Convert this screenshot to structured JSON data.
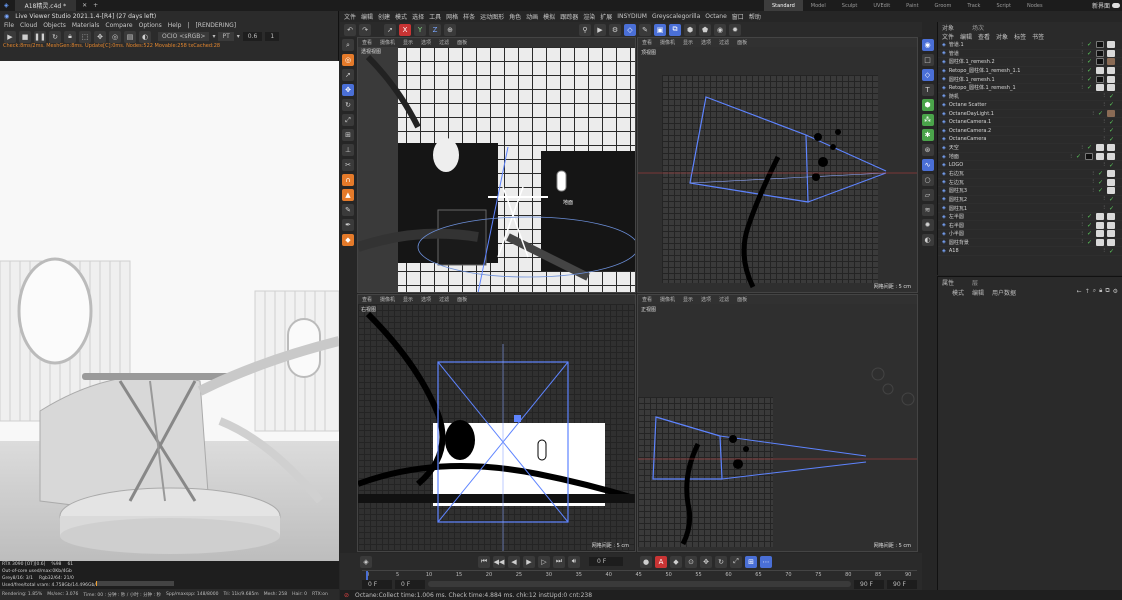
{
  "titlebar": {
    "doc_tab": "A18精灵.c4d *",
    "window_controls": [
      "─",
      "▢",
      "✕"
    ]
  },
  "liveviewer": {
    "title": "Live Viewer Studio 2021.1.4-[R4] (27 days left)",
    "menu": [
      "File",
      "Cloud",
      "Objects",
      "Materials",
      "Compare",
      "Options",
      "Help",
      "|",
      "[RENDERING]"
    ],
    "toolbar": {
      "ocio": "OCIO <sRGB>",
      "pt": "PT",
      "value": "0.6",
      "passes": "1"
    },
    "status_line": "Check:8ms/2ms. MeshGen:8ms. Update[C]:0ms. Nodes:522 Movable:258 txCached:28",
    "stats": [
      {
        "left": "RTX 3090 [OT][0.6]",
        "mid": "%98",
        "right": "61"
      },
      {
        "left": "Out-of-core used/max:0Kb/4Gb",
        "mid": "",
        "right": ""
      },
      {
        "left": "Grey8/16: 3/1",
        "mid": "Rgb32/64: 21/0",
        "right": ""
      },
      {
        "left": "Used/free/total vram: 4.758Gb/14.496Gb/24Gb",
        "mid": "",
        "right": ""
      }
    ],
    "bottom_status": {
      "rendering": "Rendering: 1.85%",
      "ms": "Ms/sec: 3.076",
      "time": "Time: 00 : 分钟 : 秒 / 小时 : 分钟 : 秒",
      "spp": "Spp/maxspp: 148/8000",
      "tri": "Tri: 11k/9.685m",
      "mesh": "Mesh: 258",
      "hair": "Hair: 0",
      "rtx": "RTX:on"
    },
    "progress": 0.0185
  },
  "c4d": {
    "menu": [
      "文件",
      "编辑",
      "创建",
      "模式",
      "选择",
      "工具",
      "网格",
      "样条",
      "运动图形",
      "角色",
      "动画",
      "模拟",
      "跟踪器",
      "渲染",
      "扩展",
      "INSYDIUM",
      "Greyscalegorilla",
      "Octane",
      "窗口",
      "帮助"
    ],
    "layouts": [
      "Standard",
      "Model",
      "Sculpt",
      "UVEdit",
      "Paint",
      "Groom",
      "Track",
      "Script",
      "Nodes"
    ],
    "active_layout": "Standard",
    "new_interface": "新界面",
    "top_toolbar": [
      "X",
      "Y",
      "Z"
    ],
    "viewports": [
      {
        "name": "透视视图",
        "menu": [
          "查看",
          "摄像机",
          "显示",
          "选项",
          "过滤",
          "面板"
        ],
        "scale": ""
      },
      {
        "name": "顶视图",
        "menu": [
          "查看",
          "摄像机",
          "显示",
          "选项",
          "过滤",
          "面板"
        ],
        "scale": "网格间距 : 5 cm"
      },
      {
        "name": "右视图",
        "menu": [
          "查看",
          "摄像机",
          "显示",
          "选项",
          "过滤",
          "面板"
        ],
        "scale": "网格间距 : 5 cm"
      },
      {
        "name": "正视图",
        "menu": [
          "查看",
          "摄像机",
          "显示",
          "选项",
          "过滤",
          "面板"
        ],
        "scale": "网格间距 : 5 cm"
      }
    ],
    "object_label": "地面",
    "timeline": {
      "frame": "0 F",
      "start": "0 F",
      "start2": "0 F",
      "end": "90 F",
      "end2": "90 F",
      "ticks": [
        "0",
        "5",
        "10",
        "15",
        "20",
        "25",
        "30",
        "35",
        "40",
        "45",
        "50",
        "55",
        "60",
        "65",
        "70",
        "75",
        "80",
        "85",
        "90"
      ],
      "current": 0
    },
    "status_bar": "Octane:Collect time:1.006 ms.  Check time:4.884 ms.  chk:12  instUpd:0  cnt:238"
  },
  "objects_panel": {
    "tabs": [
      "对象",
      "场次"
    ],
    "menu": [
      "文件",
      "编辑",
      "查看",
      "对象",
      "标签",
      "书签"
    ],
    "rows": [
      {
        "name": "管道.1",
        "tags": [
          "bk",
          "w"
        ]
      },
      {
        "name": "管道",
        "tags": [
          "bk",
          "w"
        ]
      },
      {
        "name": "圆柱体.1_remesh.2",
        "tags": [
          "bk",
          "br"
        ]
      },
      {
        "name": "Retopo_圆柱体.1_remesh_1.1",
        "tags": [
          "w",
          "w"
        ]
      },
      {
        "name": "圆柱体.1_remesh.1",
        "tags": [
          "bk",
          "w"
        ]
      },
      {
        "name": "Retopo_圆柱体.1_remesh_1",
        "tags": [
          "w",
          "w"
        ]
      },
      {
        "name": "随机",
        "tags": []
      },
      {
        "name": "Octane Scatter",
        "tags": []
      },
      {
        "name": "OctaneDayLight.1",
        "tags": [
          "br"
        ]
      },
      {
        "name": "OctaneCamera.1",
        "tags": []
      },
      {
        "name": "OctaneCamera.2",
        "tags": []
      },
      {
        "name": "OctaneCamera",
        "tags": []
      },
      {
        "name": "天空",
        "tags": [
          "w",
          "w"
        ]
      },
      {
        "name": "地面",
        "tags": [
          "bk",
          "w",
          "w"
        ]
      },
      {
        "name": "LOGO",
        "tags": []
      },
      {
        "name": "右边瓦",
        "tags": [
          "w"
        ]
      },
      {
        "name": "左边瓦",
        "tags": [
          "w"
        ]
      },
      {
        "name": "圆柱瓦3",
        "tags": [
          "w"
        ]
      },
      {
        "name": "圆柱瓦2",
        "tags": []
      },
      {
        "name": "圆柱瓦1",
        "tags": []
      },
      {
        "name": "左半圆",
        "tags": [
          "w",
          "w"
        ]
      },
      {
        "name": "右半圆",
        "tags": [
          "w",
          "w"
        ]
      },
      {
        "name": "小半圆",
        "tags": [
          "w",
          "w"
        ]
      },
      {
        "name": "圆柱背景",
        "tags": [
          "w",
          "w"
        ]
      },
      {
        "name": "A18",
        "tags": []
      }
    ],
    "attr_tabs": [
      "属性",
      "层"
    ],
    "attr_menu": [
      "模式",
      "编辑",
      "用户数据"
    ]
  },
  "colors": {
    "accent": "#4a6fd6",
    "orange": "#e47a2a",
    "ok": "#5fd35f",
    "bg": "#262626"
  }
}
